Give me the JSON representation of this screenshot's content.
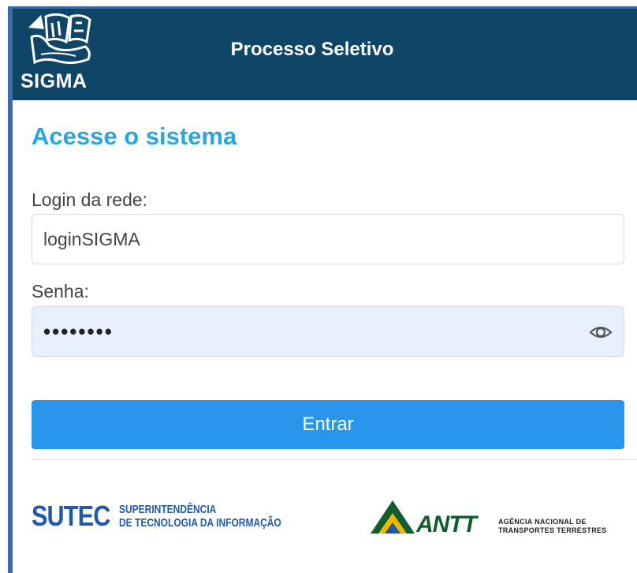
{
  "header": {
    "logo_text": "SIGMA",
    "title": "Processo Seletivo"
  },
  "form": {
    "heading": "Acesse o sistema",
    "login_label": "Login da rede:",
    "login_value": "loginSIGMA",
    "password_label": "Senha:",
    "password_value": "••••••••",
    "submit_label": "Entrar",
    "show_password_icon": "eye-icon"
  },
  "footer": {
    "sutec_main": "SUTEC",
    "sutec_line1": "SUPERINTENDÊNCIA",
    "sutec_line2": "DE TECNOLOGIA DA INFORMAÇÃO",
    "antt_word": "ANTT",
    "antt_line1": "AGÊNCIA NACIONAL DE",
    "antt_line2": "TRANSPORTES TERRESTRES"
  },
  "colors": {
    "header_bg": "#0f4567",
    "heading": "#29a6e0",
    "button": "#2896ec",
    "password_field_bg": "#e8f0fd",
    "sutec_blue": "#1f5aa6",
    "antt_green": "#0f5e2c",
    "antt_yellow": "#f2b705"
  }
}
